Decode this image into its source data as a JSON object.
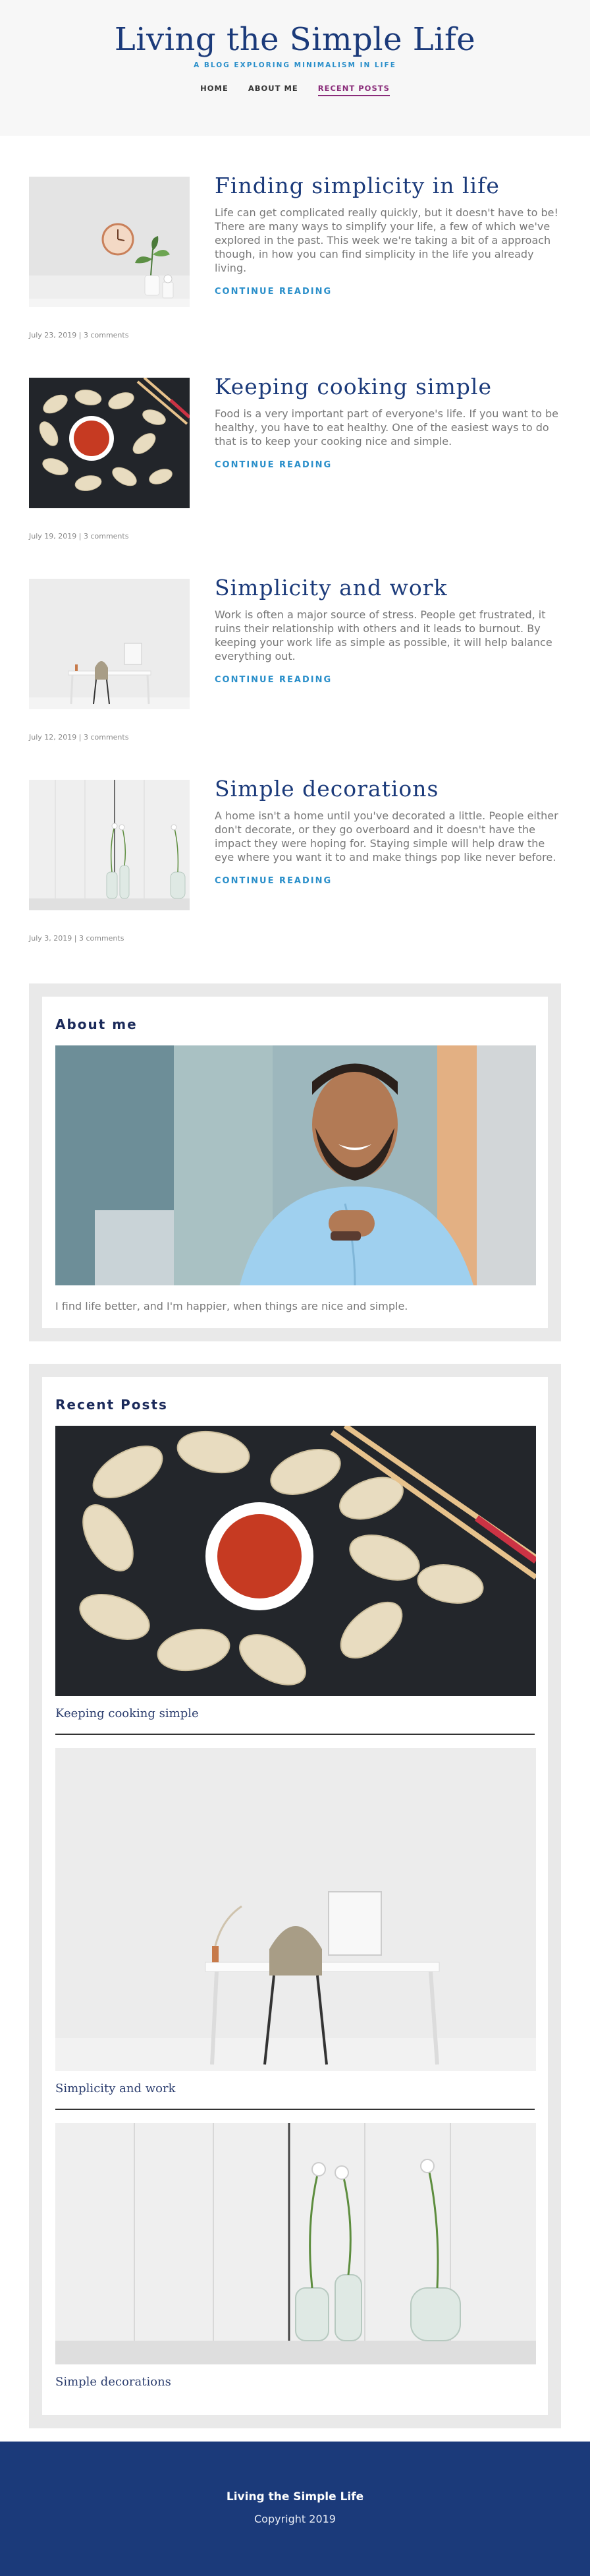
{
  "header": {
    "title": "Living the Simple Life",
    "tagline": "A BLOG EXPLORING MINIMALISM IN LIFE",
    "nav": [
      {
        "label": "HOME"
      },
      {
        "label": "ABOUT ME"
      },
      {
        "label": "RECENT POSTS"
      }
    ]
  },
  "posts": [
    {
      "title": "Finding simplicity in life",
      "excerpt": "Life can get complicated really quickly, but it doesn't have to be! There are many ways to simplify your life, a few of which we've explored in the past. This week we're taking a bit of a approach though, in how you can find simplicity in the life you already living.",
      "more": "CONTINUE READING",
      "meta": "July 23, 2019 | 3 comments"
    },
    {
      "title": "Keeping cooking simple",
      "excerpt": "Food is a very important part of everyone's life. If you want to be healthy, you have to eat healthy. One of the easiest ways to do that is to keep your cooking nice and simple.",
      "more": "CONTINUE READING",
      "meta": "July 19, 2019 | 3 comments"
    },
    {
      "title": "Simplicity and work",
      "excerpt": "Work is often a major source of stress. People get frustrated, it ruins their relationship with others and it leads to burnout. By keeping your work life as simple as possible, it will help balance everything out.",
      "more": "CONTINUE READING",
      "meta": "July 12, 2019 | 3 comments"
    },
    {
      "title": "Simple decorations",
      "excerpt": "A home isn't a home until you've decorated a little. People either don't decorate, or they go overboard and it doesn't have the impact they were hoping for. Staying simple will help draw the eye where you want it to and make things pop like never before.",
      "more": "CONTINUE READING",
      "meta": "July 3, 2019 | 3 comments"
    }
  ],
  "about": {
    "title": "About me",
    "text": "I find life better, and I'm happier, when things are nice and simple."
  },
  "recent": {
    "title": "Recent Posts",
    "items": [
      {
        "label": "Keeping cooking simple"
      },
      {
        "label": "Simplicity and work"
      },
      {
        "label": "Simple decorations"
      }
    ]
  },
  "footer": {
    "title": "Living the Simple Life",
    "copyright": "Copyright 2019"
  }
}
